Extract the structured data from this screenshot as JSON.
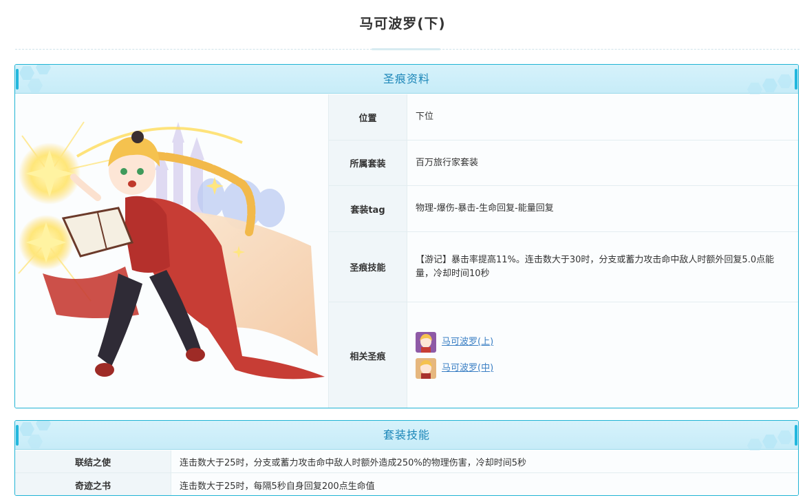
{
  "page": {
    "title": "马可波罗(下)"
  },
  "profile_panel": {
    "title": "圣痕资料",
    "rows": [
      {
        "label": "位置",
        "value": "下位"
      },
      {
        "label": "所属套装",
        "value": "百万旅行家套装"
      },
      {
        "label": "套装tag",
        "value": "物理-爆伤-暴击-生命回复-能量回复"
      },
      {
        "label": "圣痕技能",
        "value": "【游记】暴击率提高11%。连击数大于30时，分支或蓄力攻击命中敌人时额外回复5.0点能量，冷却时间10秒"
      },
      {
        "label": "相关圣痕",
        "related": [
          "马可波罗(上)",
          "马可波罗(中)"
        ]
      }
    ]
  },
  "set_panel": {
    "title": "套装技能",
    "rows": [
      {
        "label": "联结之使",
        "value": "连击数大于25时，分支或蓄力攻击命中敌人时额外造成250%的物理伤害，冷却时间5秒"
      },
      {
        "label": "奇迹之书",
        "value": "连击数大于25时，每隔5秒自身回复200点生命值"
      }
    ]
  },
  "colors": {
    "accent": "#1fb3d4",
    "header_text": "#1b86b8",
    "link": "#3a7fc4",
    "label_bg": "#f0f6f9"
  },
  "icons": {
    "thumb_upper": "character-thumb-icon",
    "thumb_middle": "character-thumb-icon"
  }
}
